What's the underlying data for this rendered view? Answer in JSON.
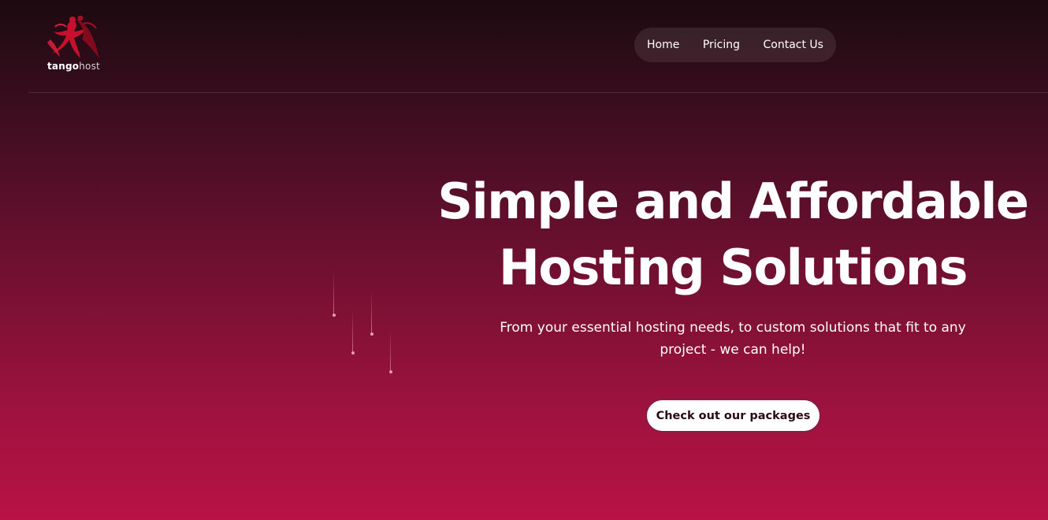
{
  "brand": {
    "name_part1": "tango",
    "name_part2": "host",
    "logo_icon": "dancing-couple-logo",
    "accent_color": "#c8102e"
  },
  "nav": {
    "items": [
      {
        "label": "Home"
      },
      {
        "label": "Pricing"
      },
      {
        "label": "Contact Us"
      }
    ]
  },
  "hero": {
    "title_line1": "Simple and Affordable",
    "title_line2": "Hosting Solutions",
    "subtitle": "From your essential hosting needs, to custom solutions that fit to any project - we can help!",
    "cta_label": "Check out our packages"
  },
  "colors": {
    "background_top": "#1c0a10",
    "background_bottom": "#b81246",
    "cta_background": "#ffffff",
    "cta_text": "#2a0a14"
  }
}
